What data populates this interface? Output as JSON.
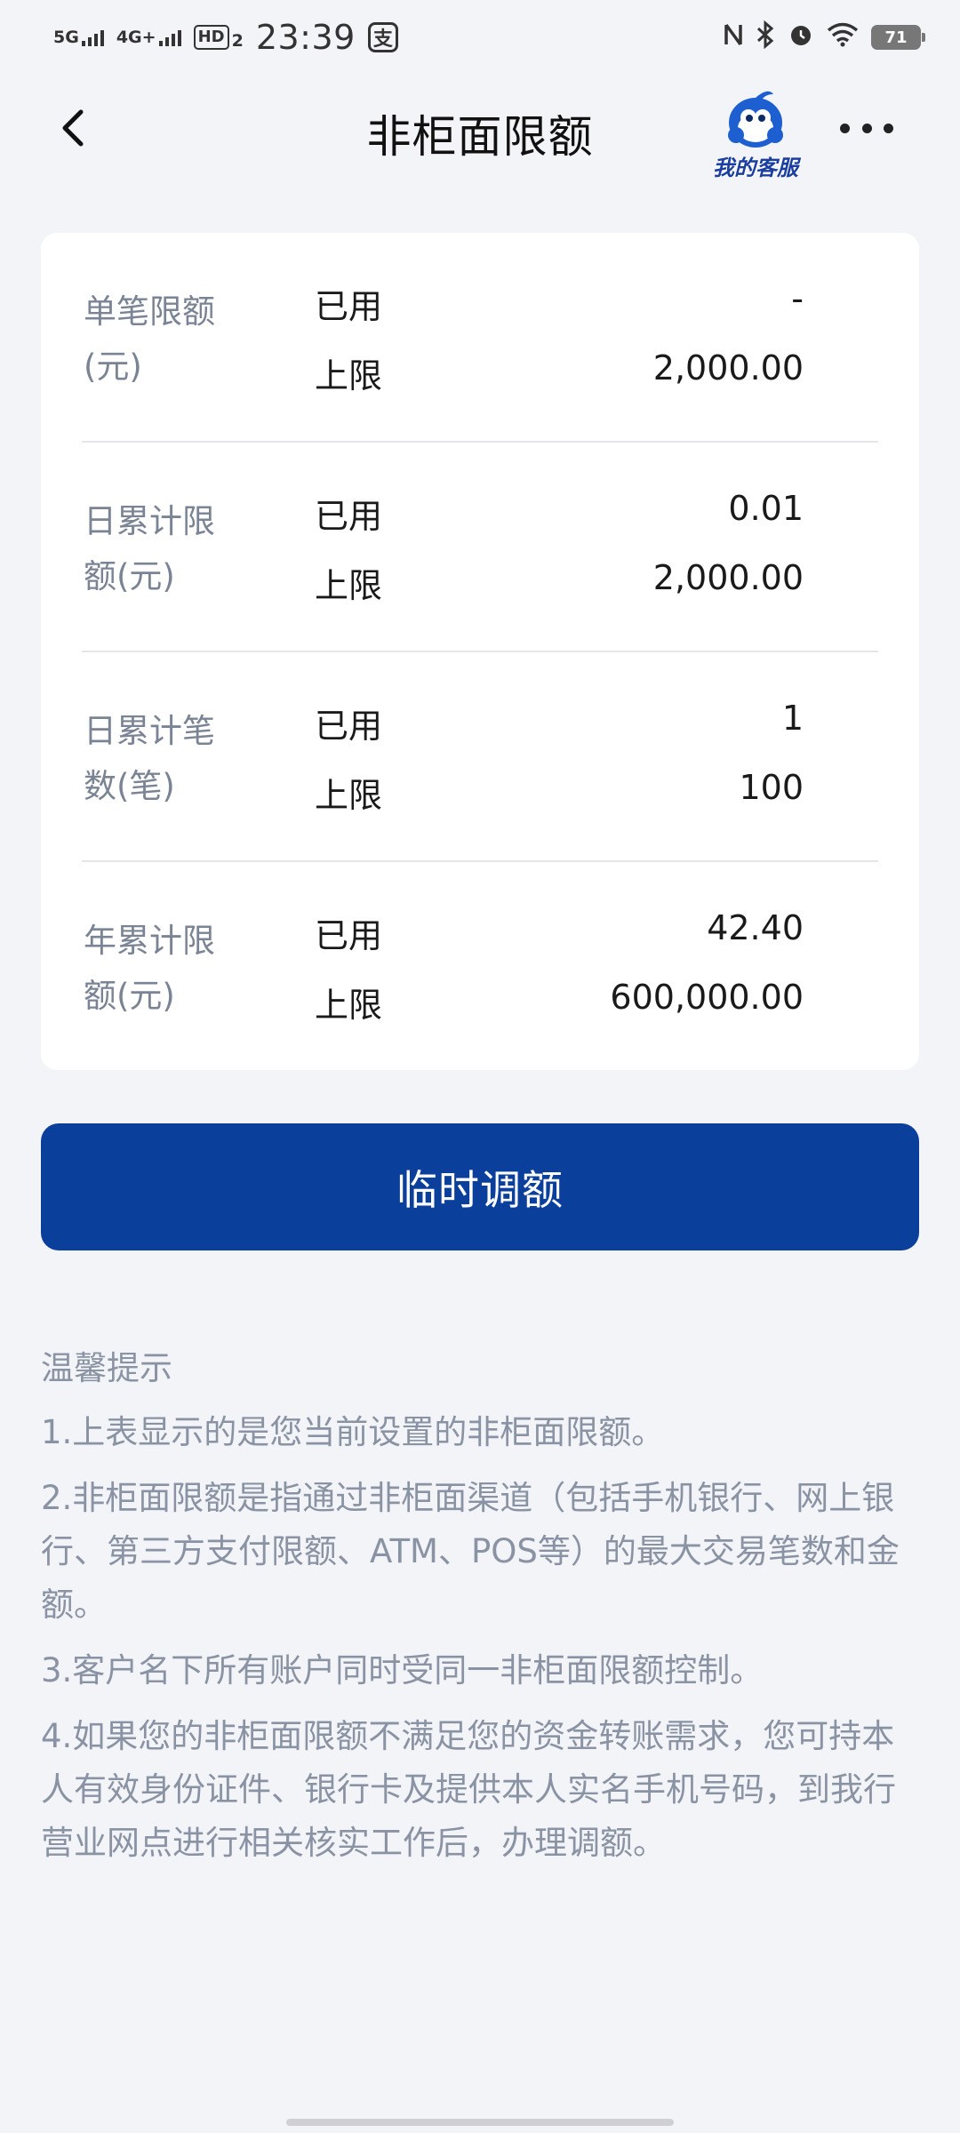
{
  "status_bar": {
    "network1": "5G",
    "network2": "4G+",
    "hd_label": "HD",
    "hd_sub": "2",
    "time": "23:39",
    "alipay_glyph": "支",
    "battery": "71",
    "icons": [
      "nfc-icon",
      "bluetooth-icon",
      "alarm-icon",
      "wifi-icon",
      "battery-icon"
    ]
  },
  "nav": {
    "title": "非柜面限额",
    "service_label": "我的客服",
    "icons": [
      "back-arrow-icon",
      "customer-service-mascot-icon",
      "more-icon"
    ]
  },
  "limits": [
    {
      "name": "单笔限额(元)",
      "used_label": "已用",
      "used_value": "-",
      "cap_label": "上限",
      "cap_value": "2,000.00"
    },
    {
      "name": "日累计限额(元)",
      "used_label": "已用",
      "used_value": "0.01",
      "cap_label": "上限",
      "cap_value": "2,000.00"
    },
    {
      "name": "日累计笔数(笔)",
      "used_label": "已用",
      "used_value": "1",
      "cap_label": "上限",
      "cap_value": "100"
    },
    {
      "name": "年累计限额(元)",
      "used_label": "已用",
      "used_value": "42.40",
      "cap_label": "上限",
      "cap_value": "600,000.00"
    }
  ],
  "adjust_button": "临时调额",
  "tips": {
    "title": "温馨提示",
    "items": [
      "1.上表显示的是您当前设置的非柜面限额。",
      "2.非柜面限额是指通过非柜面渠道（包括手机银行、网上银行、第三方支付限额、ATM、POS等）的最大交易笔数和金额。",
      "3.客户名下所有账户同时受同一非柜面限额控制。",
      "4.如果您的非柜面限额不满足您的资金转账需求，您可持本人有效身份证件、银行卡及提供本人实名手机号码，到我行营业网点进行相关核实工作后，办理调额。"
    ]
  },
  "colors": {
    "primary": "#0a3f9c",
    "page_bg": "#f3f4f8",
    "muted_text": "#8a93a3"
  }
}
